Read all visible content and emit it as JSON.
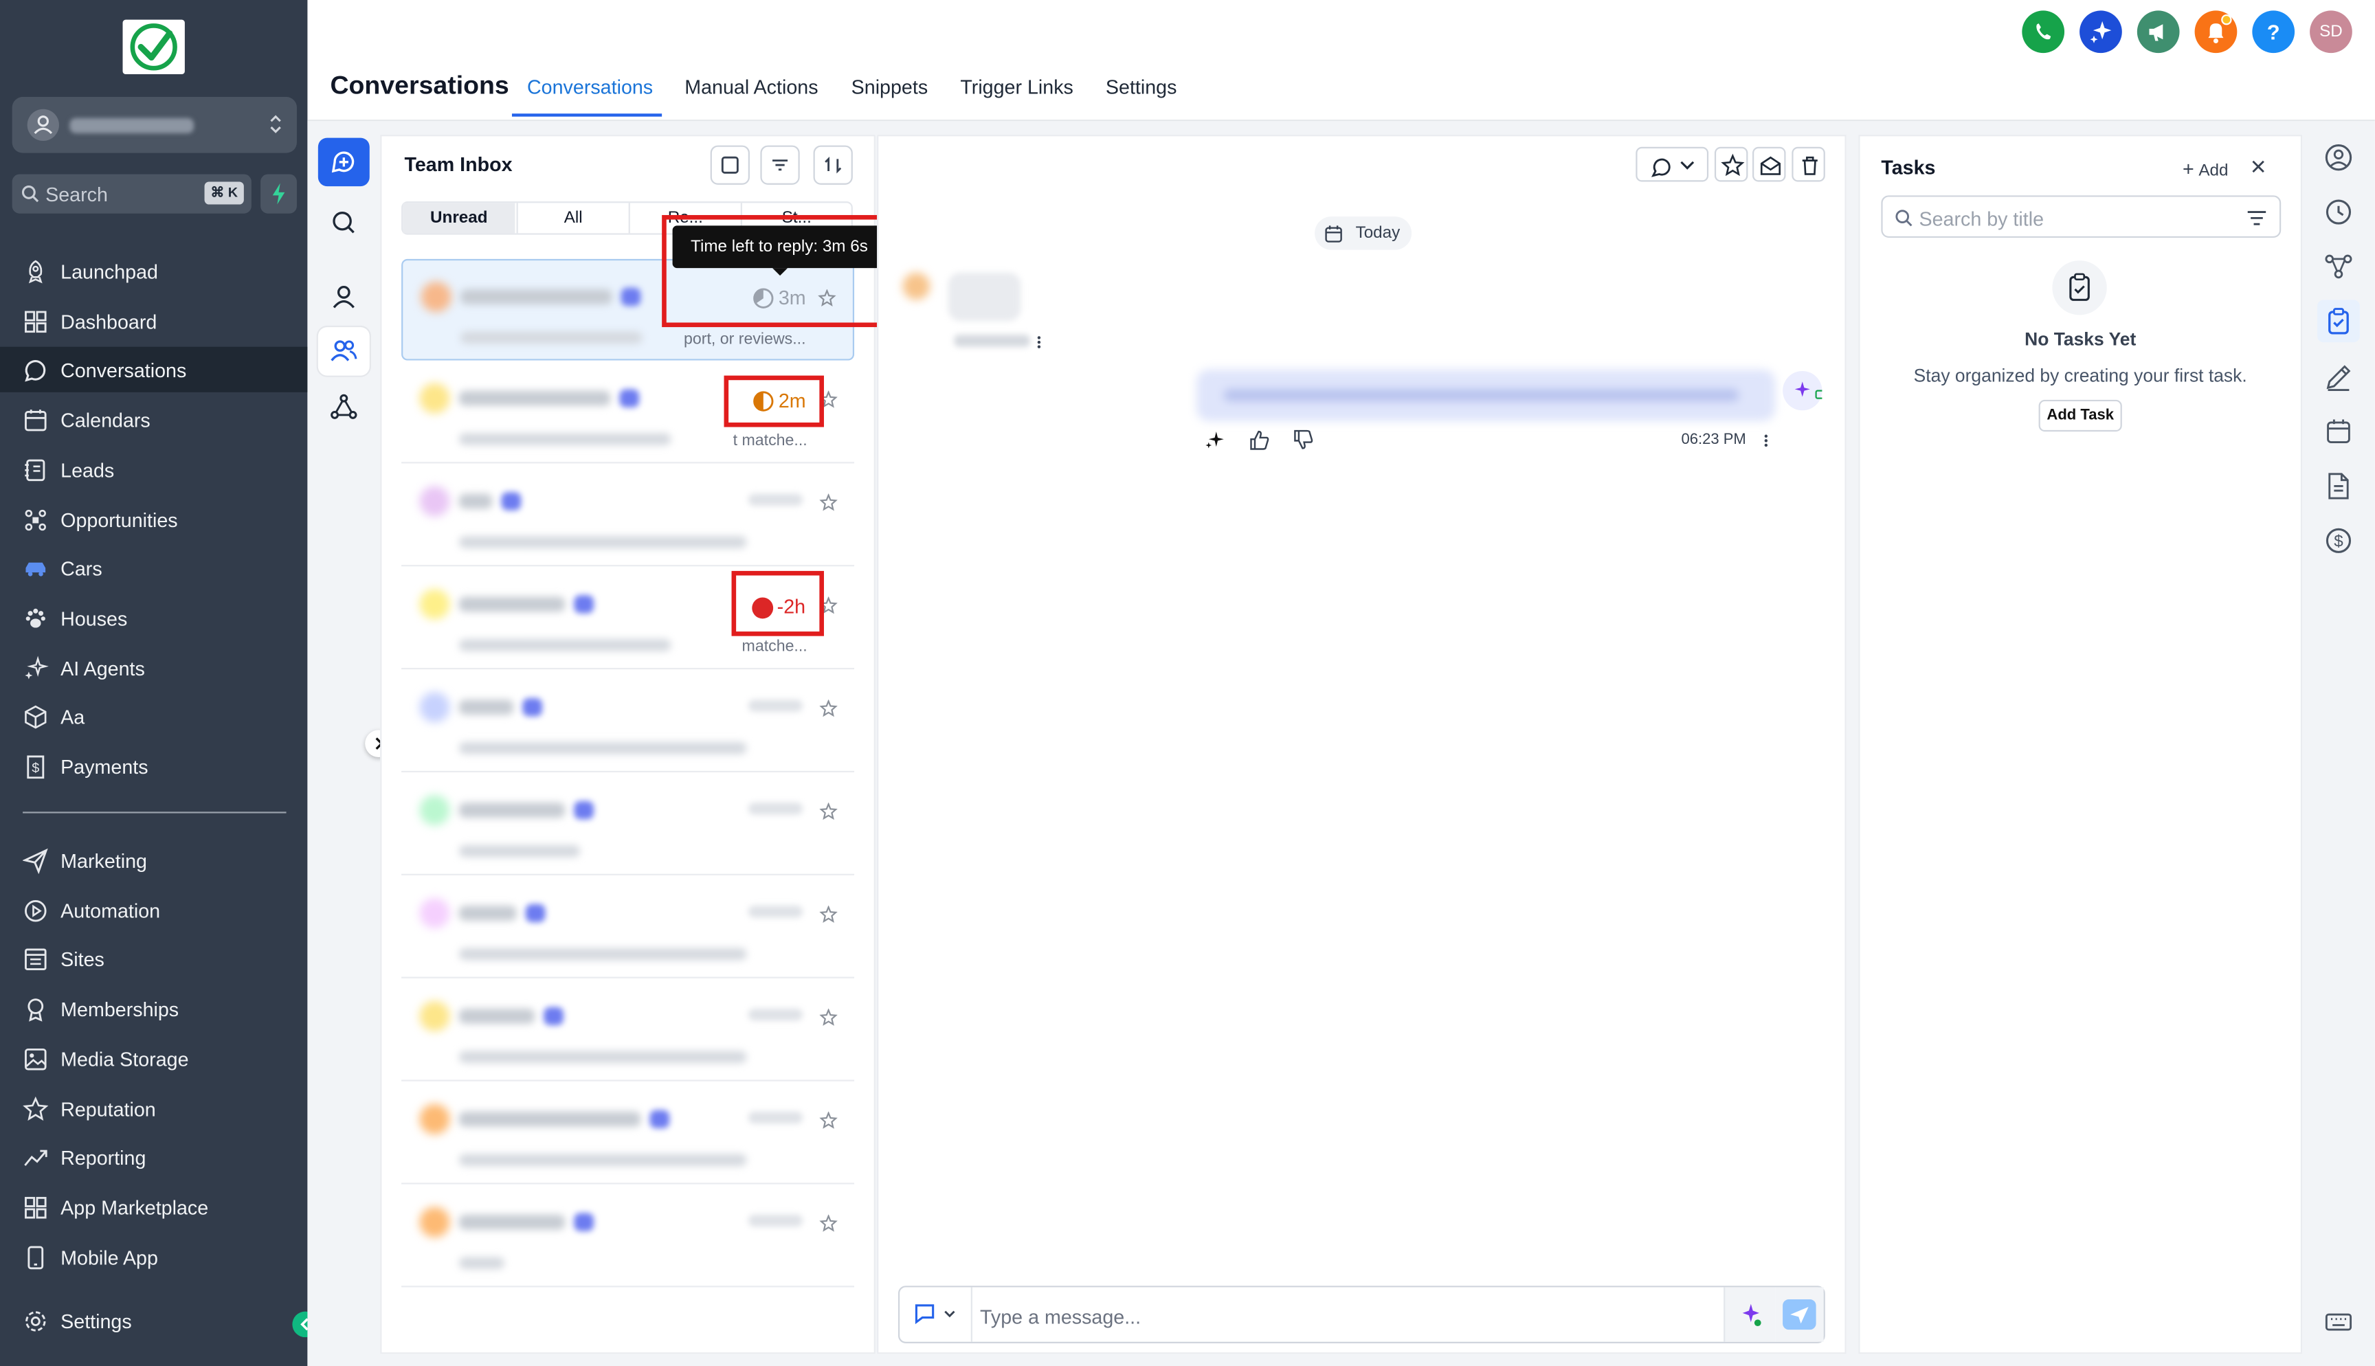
{
  "sidebar": {
    "search_placeholder": "Search",
    "search_shortcut": "⌘ K",
    "nav_top": [
      {
        "label": "Launchpad",
        "icon": "rocket-icon"
      },
      {
        "label": "Dashboard",
        "icon": "grid-icon"
      },
      {
        "label": "Conversations",
        "icon": "chat-icon",
        "active": true
      },
      {
        "label": "Calendars",
        "icon": "calendar-icon"
      },
      {
        "label": "Leads",
        "icon": "contacts-icon"
      },
      {
        "label": "Opportunities",
        "icon": "funnel-icon"
      },
      {
        "label": "Cars",
        "icon": "car-icon"
      },
      {
        "label": "Houses",
        "icon": "paw-icon"
      },
      {
        "label": "AI Agents",
        "icon": "sparkles-icon"
      },
      {
        "label": "Aa",
        "icon": "cube-icon"
      },
      {
        "label": "Payments",
        "icon": "receipt-icon"
      }
    ],
    "nav_bottom": [
      {
        "label": "Marketing",
        "icon": "send-icon"
      },
      {
        "label": "Automation",
        "icon": "automation-icon"
      },
      {
        "label": "Sites",
        "icon": "sites-icon"
      },
      {
        "label": "Memberships",
        "icon": "award-icon"
      },
      {
        "label": "Media Storage",
        "icon": "image-icon"
      },
      {
        "label": "Reputation",
        "icon": "star-icon"
      },
      {
        "label": "Reporting",
        "icon": "trend-icon"
      },
      {
        "label": "App Marketplace",
        "icon": "apps-icon"
      },
      {
        "label": "Mobile App",
        "icon": "phone-icon"
      }
    ],
    "settings_label": "Settings"
  },
  "header": {
    "title": "Conversations",
    "tabs": [
      "Conversations",
      "Manual Actions",
      "Snippets",
      "Trigger Links",
      "Settings"
    ],
    "active_tab": "Conversations",
    "avatar_initials": "SD"
  },
  "inbox": {
    "title": "Team Inbox",
    "filters": [
      "Unread",
      "All",
      "Re...",
      "St..."
    ],
    "tooltip": "Time left to reply: 3m 6s",
    "rows": [
      {
        "timer": "3m",
        "preview_tail": "port, or reviews..."
      },
      {
        "timer": "2m",
        "preview_tail": "t matche..."
      },
      {
        "timer": "",
        "preview_tail": ""
      },
      {
        "timer": "-2h",
        "preview_tail": "matche..."
      },
      {
        "timer": "",
        "preview_tail": ""
      },
      {
        "timer": "",
        "preview_tail": ""
      },
      {
        "timer": "",
        "preview_tail": ""
      },
      {
        "timer": "",
        "preview_tail": ""
      },
      {
        "timer": "",
        "preview_tail": ""
      },
      {
        "timer": "",
        "preview_tail": ""
      }
    ]
  },
  "chat": {
    "date_divider": "Today",
    "outgoing_time": "06:23 PM",
    "composer_placeholder": "Type a message..."
  },
  "tasks": {
    "title": "Tasks",
    "add_label": "Add",
    "search_placeholder": "Search by title",
    "empty_title": "No Tasks Yet",
    "empty_subtitle": "Stay organized by creating your first task.",
    "add_task_label": "Add Task"
  },
  "colors": {
    "sidebar_bg": "#323c4b",
    "accent": "#2563eb",
    "timer_warn": "#d97706",
    "timer_overdue": "#dc2626",
    "highlight_box": "#e11d1d"
  }
}
